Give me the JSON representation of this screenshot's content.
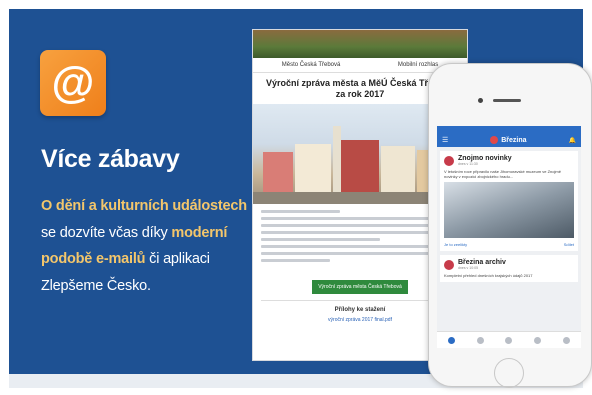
{
  "card": {
    "icon_glyph": "@",
    "heading": "Více zábavy",
    "desc_hl1": "O dění a kulturních událostech",
    "desc_t1": " se dozvíte včas díky ",
    "desc_hl2": "moderní podobě e-mailů",
    "desc_t2": " či aplikaci Zlepšeme Česko."
  },
  "colors": {
    "panel_bg": "#1e5193",
    "highlight": "#f3c66b",
    "icon_orange": "#ef7f1a"
  },
  "email_mockup": {
    "nav_left": "Město Česká Třebová",
    "nav_right": "Mobilní rozhlas",
    "title": "Výroční zpráva města a MěÚ Česká Třebová za rok 2017",
    "button": "Výroční zpráva města Česká Třebová",
    "attachments": "Přílohy ke stažení",
    "attachment_link": "výroční zpráva 2017 final.pdf"
  },
  "phone_mockup": {
    "app_title": "Březina",
    "card1_title": "Znojmo novinky",
    "card1_sub": "dnes v 11:30",
    "card1_text": "V letošním roce připravilo naše Jihomoravské muzeum ve Znojmě novinky v expozici zbojnického hradu...",
    "card1_action_left": "Je to zeelikty",
    "card1_action_right": "Sdílet",
    "card2_title": "Březina archiv",
    "card2_sub": "dnes v 10:05",
    "card2_text": "Kompletní přehled dnešních krajských údajů 2017"
  }
}
